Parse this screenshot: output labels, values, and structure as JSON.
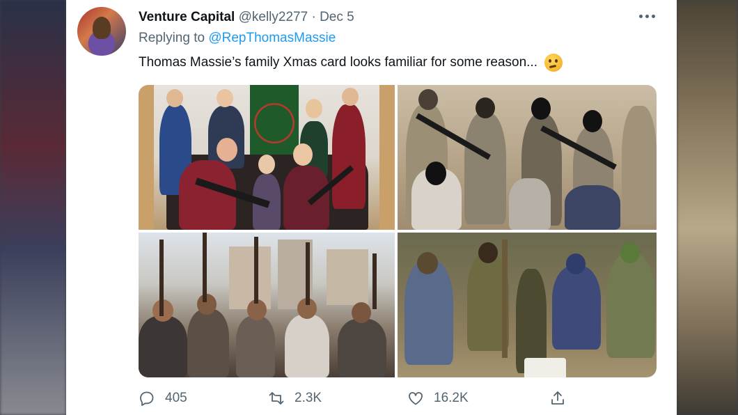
{
  "tweet": {
    "author_name": "Venture Capital",
    "author_handle": "@kelly2277",
    "separator": "·",
    "date": "Dec 5",
    "reply_prefix": "Replying to",
    "reply_to": "@RepThomasMassie",
    "text": "Thomas Massie’s family Xmas card looks familiar for some reason...",
    "emoji_icon": "thinking-face-icon"
  },
  "actions": {
    "reply_count": "405",
    "retweet_count": "2.3K",
    "like_count": "16.2K",
    "icons": [
      "reply-icon",
      "retweet-icon",
      "like-icon",
      "share-icon"
    ]
  },
  "colors": {
    "text": "#0f1419",
    "secondary": "#536471",
    "link": "#1d9bf0",
    "card_bg": "#ffffff"
  }
}
